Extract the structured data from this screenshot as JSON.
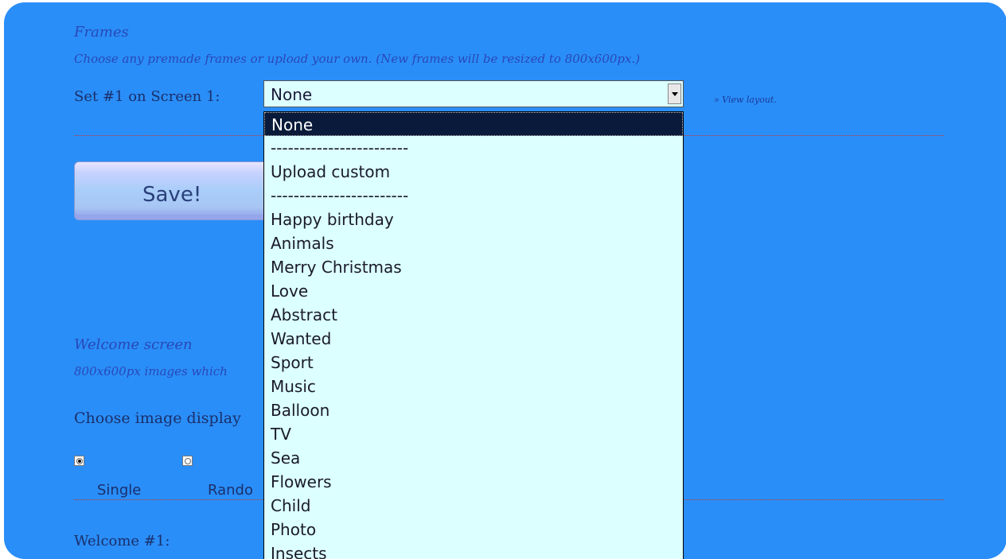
{
  "frames": {
    "title": "Frames",
    "description": "Choose any premade frames or upload your own. (New frames will be resized to 800x600px.)",
    "set_label": "Set #1 on Screen 1:",
    "selected_value": "None",
    "view_layout_link": "» View layout.",
    "options": [
      "None",
      "------------------------",
      "Upload custom",
      "------------------------",
      "Happy birthday",
      "Animals",
      "Merry Christmas",
      "Love",
      "Abstract",
      "Wanted",
      "Sport",
      "Music",
      "Balloon",
      "TV",
      "Sea",
      "Flowers",
      "Child",
      "Photo",
      "Insects"
    ]
  },
  "save_button": {
    "label": "Save!"
  },
  "welcome": {
    "title": "Welcome screen",
    "description_visible": "800x600px images which",
    "display_label_visible": "Choose image display",
    "radio_single": {
      "label": "Single",
      "checked": true
    },
    "radio_random": {
      "label_visible": "Rando",
      "checked": false
    },
    "welcome1_label": "Welcome #1:"
  },
  "colors": {
    "panel_bg": "#2a8ef8",
    "dropdown_bg": "#dcffff",
    "selected_option_bg": "#0a1a3a",
    "separator": "#c0392b"
  }
}
